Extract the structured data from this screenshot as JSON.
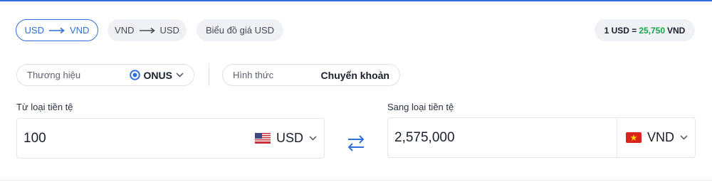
{
  "tabs": [
    {
      "from": "USD",
      "to": "VND",
      "active": true
    },
    {
      "from": "VND",
      "to": "USD",
      "active": false
    },
    {
      "label": "Biểu đồ giá USD",
      "active": false
    }
  ],
  "rate": {
    "prefix": "1 USD =",
    "value": "25,750",
    "suffix": "VND",
    "value_color": "#17a34a"
  },
  "brand": {
    "label": "Thương hiệu",
    "value": "ONUS",
    "icon": "radio-dot-icon"
  },
  "method": {
    "label": "Hình thức",
    "value": "Chuyển khoản"
  },
  "from": {
    "label": "Từ loại tiền tệ",
    "amount": "100",
    "currency": "USD",
    "flag": "us-flag-icon"
  },
  "to": {
    "label": "Sang loại tiền tệ",
    "amount": "2,575,000",
    "currency": "VND",
    "flag": "vn-flag-icon"
  },
  "colors": {
    "accent": "#2f6fdc",
    "green": "#17a34a",
    "pill_bg": "#f0f1f4",
    "border": "#dfe1e6"
  },
  "swap_icon": "swap-arrows-icon"
}
